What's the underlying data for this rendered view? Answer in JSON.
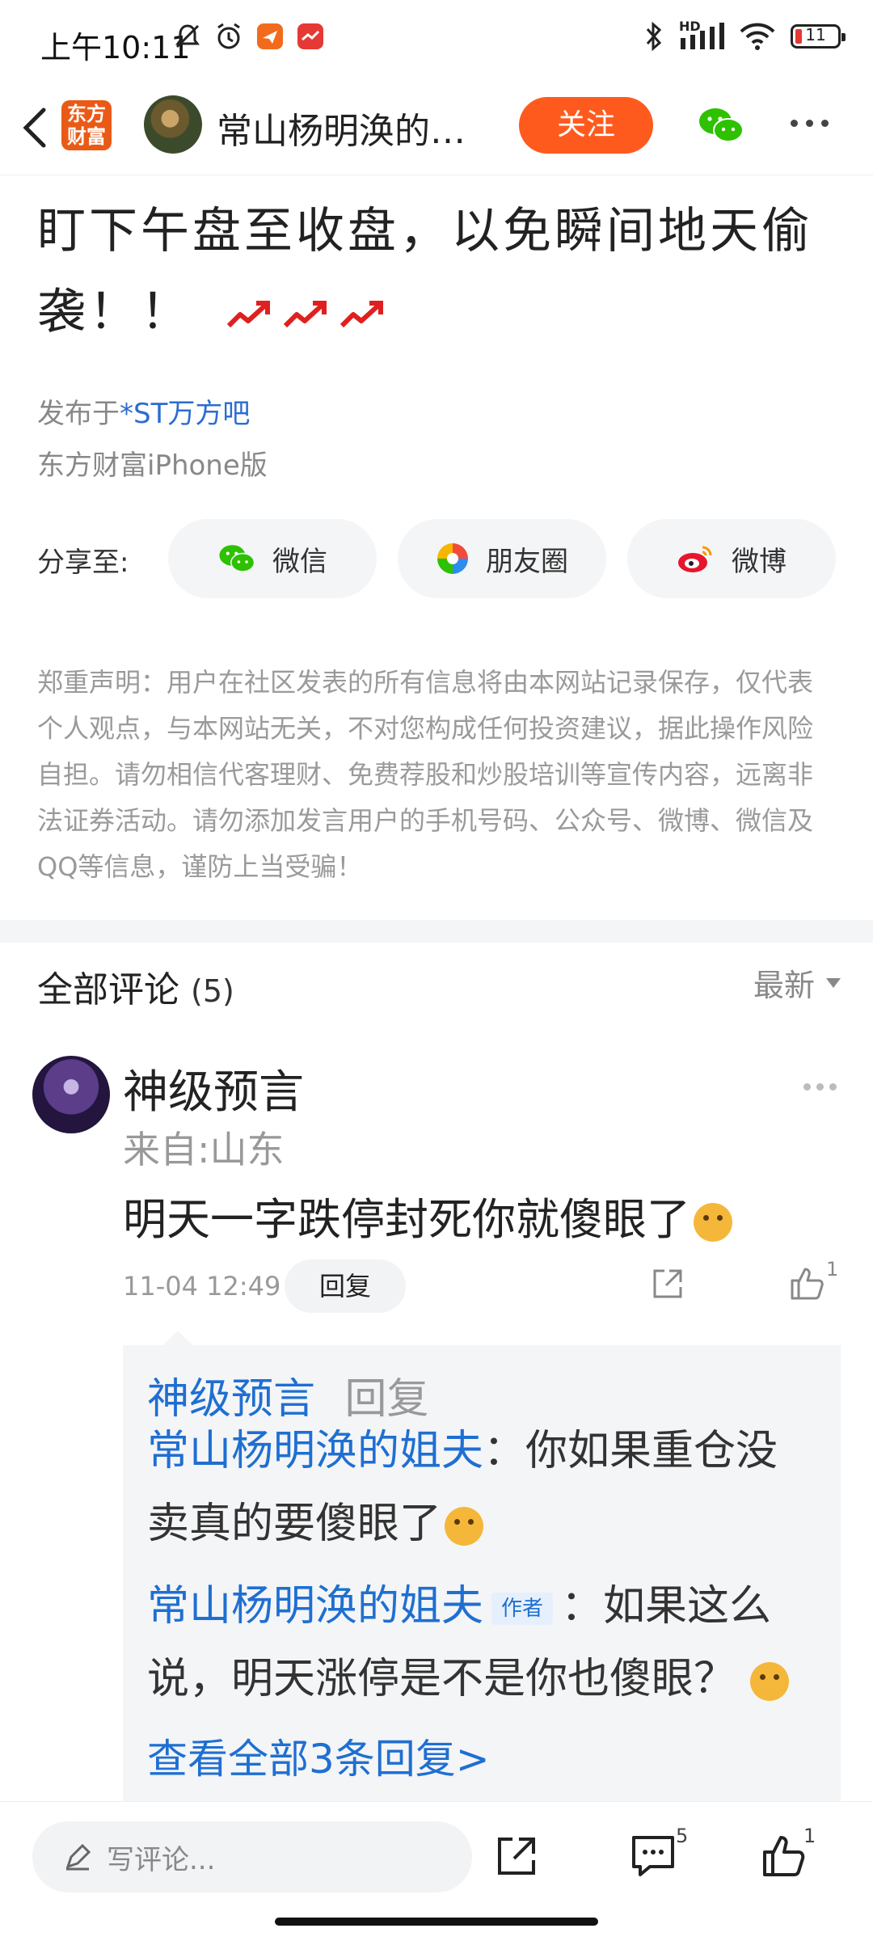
{
  "status_bar": {
    "time": "上午10:11",
    "battery_level": "11",
    "network_label": "HD"
  },
  "nav": {
    "logo_text": "东方财富",
    "title": "常山杨明涣的姐夫",
    "follow_label": "关注"
  },
  "article": {
    "text": "盯下午盘至收盘，以免瞬间地天偷袭！！",
    "forum_prefix": "发布于",
    "forum_name": "*ST万方吧",
    "source": "东方财富iPhone版",
    "share_label": "分享至:",
    "share_buttons": [
      {
        "label": "微信",
        "icon": "wechat-icon"
      },
      {
        "label": "朋友圈",
        "icon": "moments-icon"
      },
      {
        "label": "微博",
        "icon": "weibo-icon"
      }
    ],
    "disclaimer": "郑重声明：用户在社区发表的所有信息将由本网站记录保存，仅代表个人观点，与本网站无关，不对您构成任何投资建议，据此操作风险自担。请勿相信代客理财、免费荐股和炒股培训等宣传内容，远离非法证券活动。请勿添加发言用户的手机号码、公众号、微博、微信及QQ等信息，谨防上当受骗！"
  },
  "comments": {
    "title": "全部评论",
    "count": "(5)",
    "sort_label": "最新",
    "items": [
      {
        "user": "神级预言",
        "location": "来自:山东",
        "text": "明天一字跌停封死你就傻眼了",
        "time": "11-04 12:49",
        "reply_label": "回复",
        "like_count": "1",
        "replies": {
          "head_user": "神级预言",
          "head_action": "回复",
          "items": [
            {
              "user": "常山杨明涣的姐夫",
              "tag": "",
              "text": "你如果重仓没卖真的要傻眼了"
            },
            {
              "user": "常山杨明涣的姐夫",
              "tag": "作者",
              "text": "如果这么说，明天涨停是不是你也傻眼？"
            }
          ],
          "view_all": "查看全部3条回复>"
        }
      }
    ]
  },
  "bottom_bar": {
    "input_placeholder": "写评论...",
    "comment_count": "5",
    "like_count": "1"
  }
}
